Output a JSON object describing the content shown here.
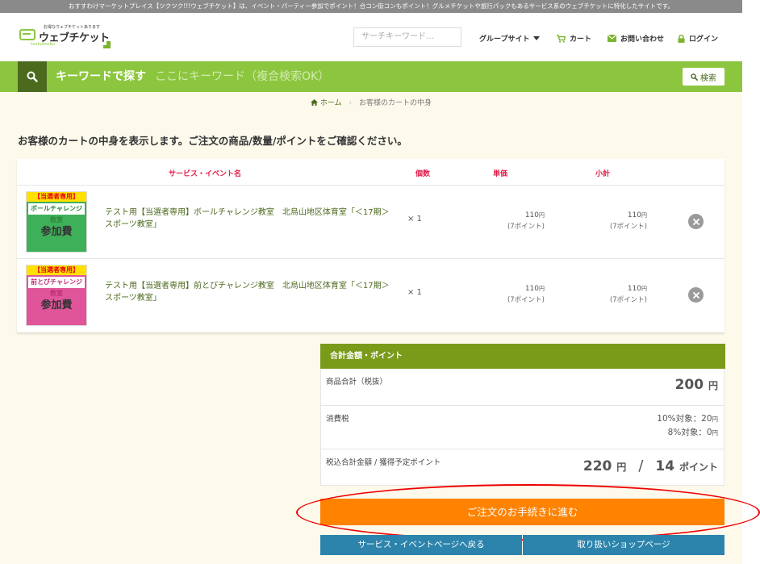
{
  "topbar": {
    "text": "おすすわけマーケットプレイス【ツクツク!!!ウェブチケット】は、イベント・パーティー参加でポイント！合コン街コンもポイント！グルメチケットや旅行パックもあるサービス系のウェブチケットに特化したサイトです。"
  },
  "logo": {
    "tagline": "お得なウェブチケットあります",
    "name": "ウェブチケット",
    "sub": "tsukutsuku"
  },
  "header": {
    "search_placeholder": "サーチキーワード…",
    "nav_group": "グループサイト",
    "nav_cart": "カート",
    "nav_contact": "お問い合わせ",
    "nav_login": "ログイン"
  },
  "search": {
    "label": "キーワードで探す",
    "placeholder": "ここにキーワード（複合検索OK）",
    "button": "検索"
  },
  "breadcrumb": {
    "home": "ホーム",
    "current": "お客様のカートの中身"
  },
  "lead": "お客様のカートの中身を表示します。ご注文の商品/数量/ポイントをご確認ください。",
  "cart": {
    "headers": {
      "name": "サービス・イベント名",
      "qty": "個数",
      "unit": "単価",
      "subtotal": "小計"
    },
    "items": [
      {
        "thumb_header": "【当選者専用】",
        "thumb_title": "ボールチャレンジ教室",
        "thumb_big": "参加費",
        "name": "テスト用【当選者専用】ボールチャレンジ教室　北烏山地区体育室「＜17期＞スポーツ教室」",
        "qty": "× 1",
        "unit_price": "110",
        "unit_points": "(7ポイント)",
        "sub_price": "110",
        "sub_points": "(7ポイント)"
      },
      {
        "thumb_header": "【当選者専用】",
        "thumb_title": "前とびチャレンジ教室",
        "thumb_big": "参加費",
        "name": "テスト用【当選者専用】前とびチャレンジ教室　北烏山地区体育室「＜17期＞スポーツ教室」",
        "qty": "× 1",
        "unit_price": "110",
        "unit_points": "(7ポイント)",
        "sub_price": "110",
        "sub_points": "(7ポイント)"
      }
    ],
    "yen": "円"
  },
  "summary": {
    "title": "合計金額・ポイント",
    "subtotal_label": "商品合計（税抜）",
    "subtotal_value": "200",
    "tax_label": "消費税",
    "tax_10": "10%対象：20",
    "tax_8": "8%対象：0",
    "total_label": "税込合計金額 / 獲得予定ポイント",
    "total_value": "220",
    "points_value": "14",
    "points_unit": "ポイント",
    "slash": "/",
    "yen": "円"
  },
  "actions": {
    "proceed": "ご注文のお手続きに進む",
    "back": "サービス・イベントページへ戻る",
    "shop": "取り扱いショップページ"
  },
  "colors": {
    "brand_green": "#8cc63f",
    "dark_green": "#4c6a1e",
    "header_red": "#e11d48",
    "summary_olive": "#7a9a1a",
    "proceed_orange": "#ff8200",
    "button_blue": "#2c84ad",
    "highlight_red": "#ee0000"
  }
}
